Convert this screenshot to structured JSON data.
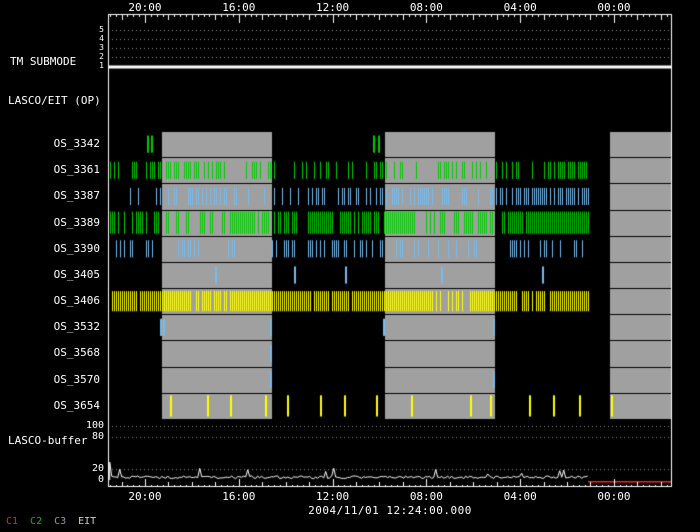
{
  "panels": {
    "tm_submode_label": "TM SUBMODE",
    "lasco_eit_label": "LASCO/EIT (OP)",
    "buffer_label": "LASCO-buffer"
  },
  "footer": {
    "datetime": "2004/11/01 12:24:00.000"
  },
  "legend": {
    "items": [
      {
        "label": "C1",
        "color": "#cc3333"
      },
      {
        "label": "C2",
        "color": "#00bb00"
      },
      {
        "label": "C3",
        "color": "#8899aa"
      },
      {
        "label": "EIT",
        "color": "#cccccc"
      }
    ]
  },
  "chart_data": {
    "type": "timeline",
    "title": "LASCO/EIT operations timeline",
    "time_axis": {
      "tick_labels": [
        "20:00",
        "16:00",
        "12:00",
        "08:00",
        "04:00",
        "00:00"
      ],
      "tick_fracs": [
        0.0656,
        0.2319,
        0.3982,
        0.5645,
        0.7308,
        0.8971
      ],
      "quarter_frac": 0.0103925,
      "first_quarter_frac": 0.003245
    },
    "shaded_bands_frac": [
      [
        0.0957,
        0.2908
      ],
      [
        0.4911,
        0.6862
      ],
      [
        0.8901,
        1.0
      ]
    ],
    "tm_submode": {
      "range_labels": [
        "5",
        "4",
        "3",
        "2",
        "1"
      ],
      "value": 1
    },
    "rows": [
      {
        "label": "OS_3342",
        "color": "#00cc00",
        "pattern": "sparse",
        "ticks": [
          0.069,
          0.077,
          0.47,
          0.478
        ]
      },
      {
        "label": "OS_3361",
        "color": "#00cc00",
        "pattern": "dense",
        "start": 0.004,
        "end": 0.853,
        "density": 0.5
      },
      {
        "label": "OS_3387",
        "color": "#77bbee",
        "pattern": "dense",
        "start": 0.004,
        "end": 0.853,
        "density": 0.45
      },
      {
        "label": "OS_3389",
        "color": "#00cc00",
        "pattern": "dense",
        "start": 0.004,
        "end": 0.853,
        "density": 0.8,
        "pad": 2
      },
      {
        "label": "OS_3390",
        "color": "#77bbee",
        "pattern": "dense",
        "start": 0.004,
        "end": 0.853,
        "density": 0.3
      },
      {
        "label": "OS_3405",
        "color": "#77bbee",
        "pattern": "sparse",
        "ticks": [
          0.19,
          0.33,
          0.42,
          0.59,
          0.77
        ]
      },
      {
        "label": "OS_3406",
        "color": "#ffff00",
        "pattern": "dense",
        "start": 0.004,
        "end": 0.853,
        "density": 0.9,
        "pad": 3
      },
      {
        "label": "OS_3532",
        "color": "#77bbee",
        "pattern": "sparse",
        "ticks": [
          0.092,
          0.097,
          0.287,
          0.487,
          0.683
        ]
      },
      {
        "label": "OS_3568",
        "color": "#77bbee",
        "pattern": "sparse",
        "ticks": [
          0.287
        ]
      },
      {
        "label": "OS_3570",
        "color": "#77bbee",
        "pattern": "sparse",
        "ticks": [
          0.287,
          0.683
        ]
      },
      {
        "label": "OS_3654",
        "color": "#ffff00",
        "pattern": "spaced",
        "start": 0.012,
        "end": 0.894,
        "count": 18,
        "jitter": 10,
        "skip_chance": 0.08,
        "tick_width": 2,
        "pad": 2.5
      }
    ],
    "buffer": {
      "ylim": [
        0,
        100
      ],
      "scale_labels": [
        "100",
        "80",
        "20",
        "0"
      ],
      "scale_values": [
        100,
        80,
        20,
        0
      ],
      "gridline_values": [
        100,
        80,
        20
      ],
      "trace": {
        "start_frac": 0.003,
        "end_frac": 0.853,
        "base": 2.5,
        "noise": 5,
        "spike_chance": 0.06,
        "spike_extra": 12,
        "initial_value": 33
      },
      "red_line": {
        "start_frac": 0.851,
        "end_frac": 1.0,
        "value": 0,
        "color": "#ff2222"
      }
    },
    "colors": {
      "band": "#a0a0a0",
      "axis": "#ffffff",
      "grid_dots": "rgba(255,255,255,0.55)",
      "tm_trace": "#ffffff",
      "buffer_trace": "#ffffff"
    },
    "seed": 20041101
  }
}
